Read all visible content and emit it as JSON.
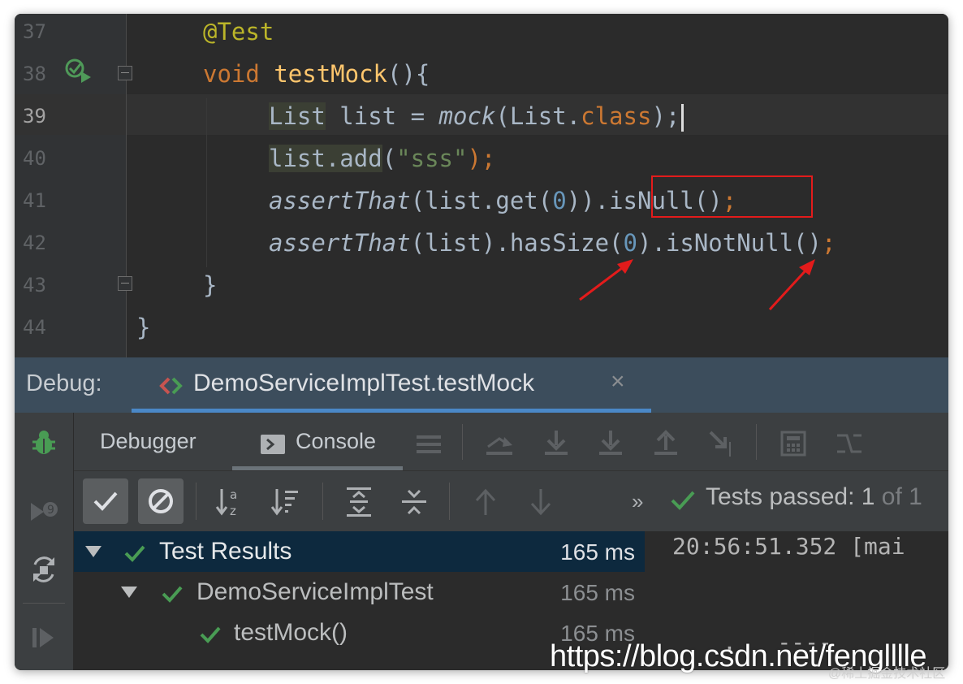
{
  "editor": {
    "lines": [
      {
        "num": "37"
      },
      {
        "num": "38"
      },
      {
        "num": "39"
      },
      {
        "num": "40"
      },
      {
        "num": "41"
      },
      {
        "num": "42"
      },
      {
        "num": "43"
      },
      {
        "num": "44"
      }
    ],
    "code": {
      "l37_annotation": "@Test",
      "l38_void": "void",
      "l38_name": "testMock",
      "l38_rest": "(){",
      "l39_list_type": "List",
      "l39_mid": " list = ",
      "l39_mock": "mock",
      "l39_arg": "(List.",
      "l39_class": "class",
      "l39_end": ");",
      "l40_call": "list.add",
      "l40_open": "(",
      "l40_str": "\"sss\"",
      "l40_end": ");",
      "l41_assert": "assertThat",
      "l41_a": "(list.get(",
      "l41_zero": "0",
      "l41_b": ")).",
      "l41_isnull": "isNull()",
      "l41_semi": ";",
      "l42_assert": "assertThat",
      "l42_a": "(list).hasSize(",
      "l42_zero": "0",
      "l42_b": ").isNotNull()",
      "l42_semi": ";",
      "l43": "}",
      "l44": "}"
    }
  },
  "debug": {
    "title": "Debug:",
    "tab_label": "DemoServiceImplTest.testMock",
    "close_glyph": "×"
  },
  "toolbar": {
    "debugger_label": "Debugger",
    "console_label": "Console",
    "more_glyph": "»",
    "tests_passed_prefix": "Tests passed: ",
    "tests_passed_count": "1",
    "tests_passed_suffix": " of 1"
  },
  "tree": {
    "rows": [
      {
        "label": "Test Results",
        "time": "165 ms"
      },
      {
        "label": "DemoServiceImplTest",
        "time": "165 ms"
      },
      {
        "label": "testMock()",
        "time": "165 ms"
      }
    ]
  },
  "console": {
    "line1": "20:56:51.352 [mai",
    "line2": ".   ----"
  },
  "watermark": {
    "url": "https://blog.csdn.net/fenglllle",
    "site": "@稀土掘金技术社区"
  },
  "icons": {
    "accent": "#4a88c7",
    "success": "#499c54",
    "arrow": "#e31b1b"
  }
}
